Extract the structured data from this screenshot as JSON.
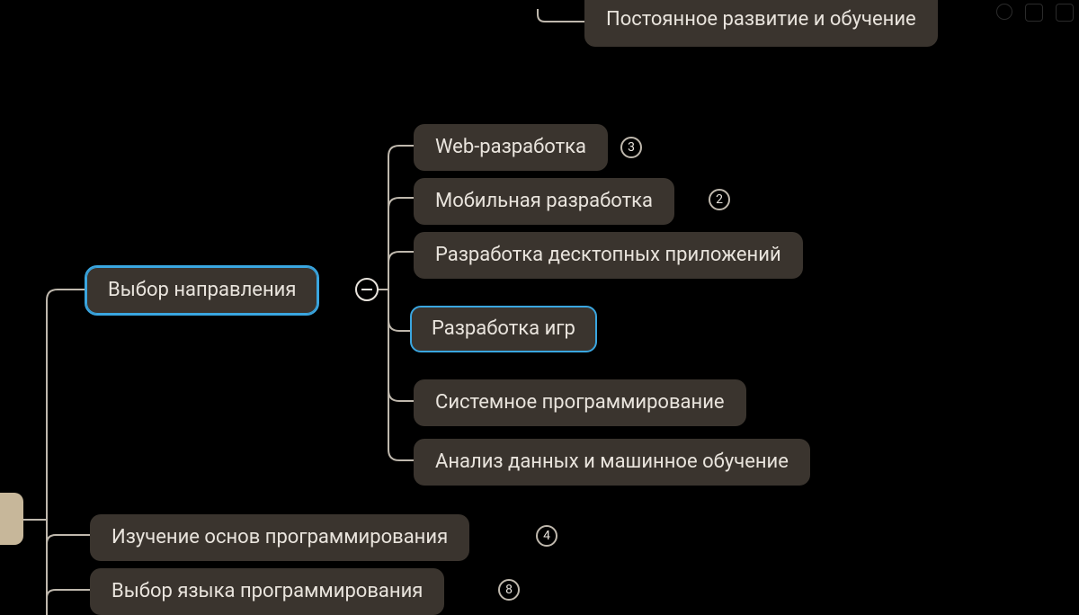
{
  "top_orphan": {
    "label": "Постоянное развитие и обучение"
  },
  "parent": {
    "label": "Выбор направления",
    "children": [
      {
        "label": "Web-разработка",
        "count": 3
      },
      {
        "label": "Мобильная разработка",
        "count": 2
      },
      {
        "label": "Разработка десктопных приложений"
      },
      {
        "label": "Разработка игр",
        "selected": true
      },
      {
        "label": "Системное программирование"
      },
      {
        "label": "Анализ данных и машинное обучение"
      }
    ]
  },
  "siblings_below": [
    {
      "label": "Изучение основ программирования",
      "count": 4
    },
    {
      "label": "Выбор языка программирования",
      "count": 8
    }
  ]
}
